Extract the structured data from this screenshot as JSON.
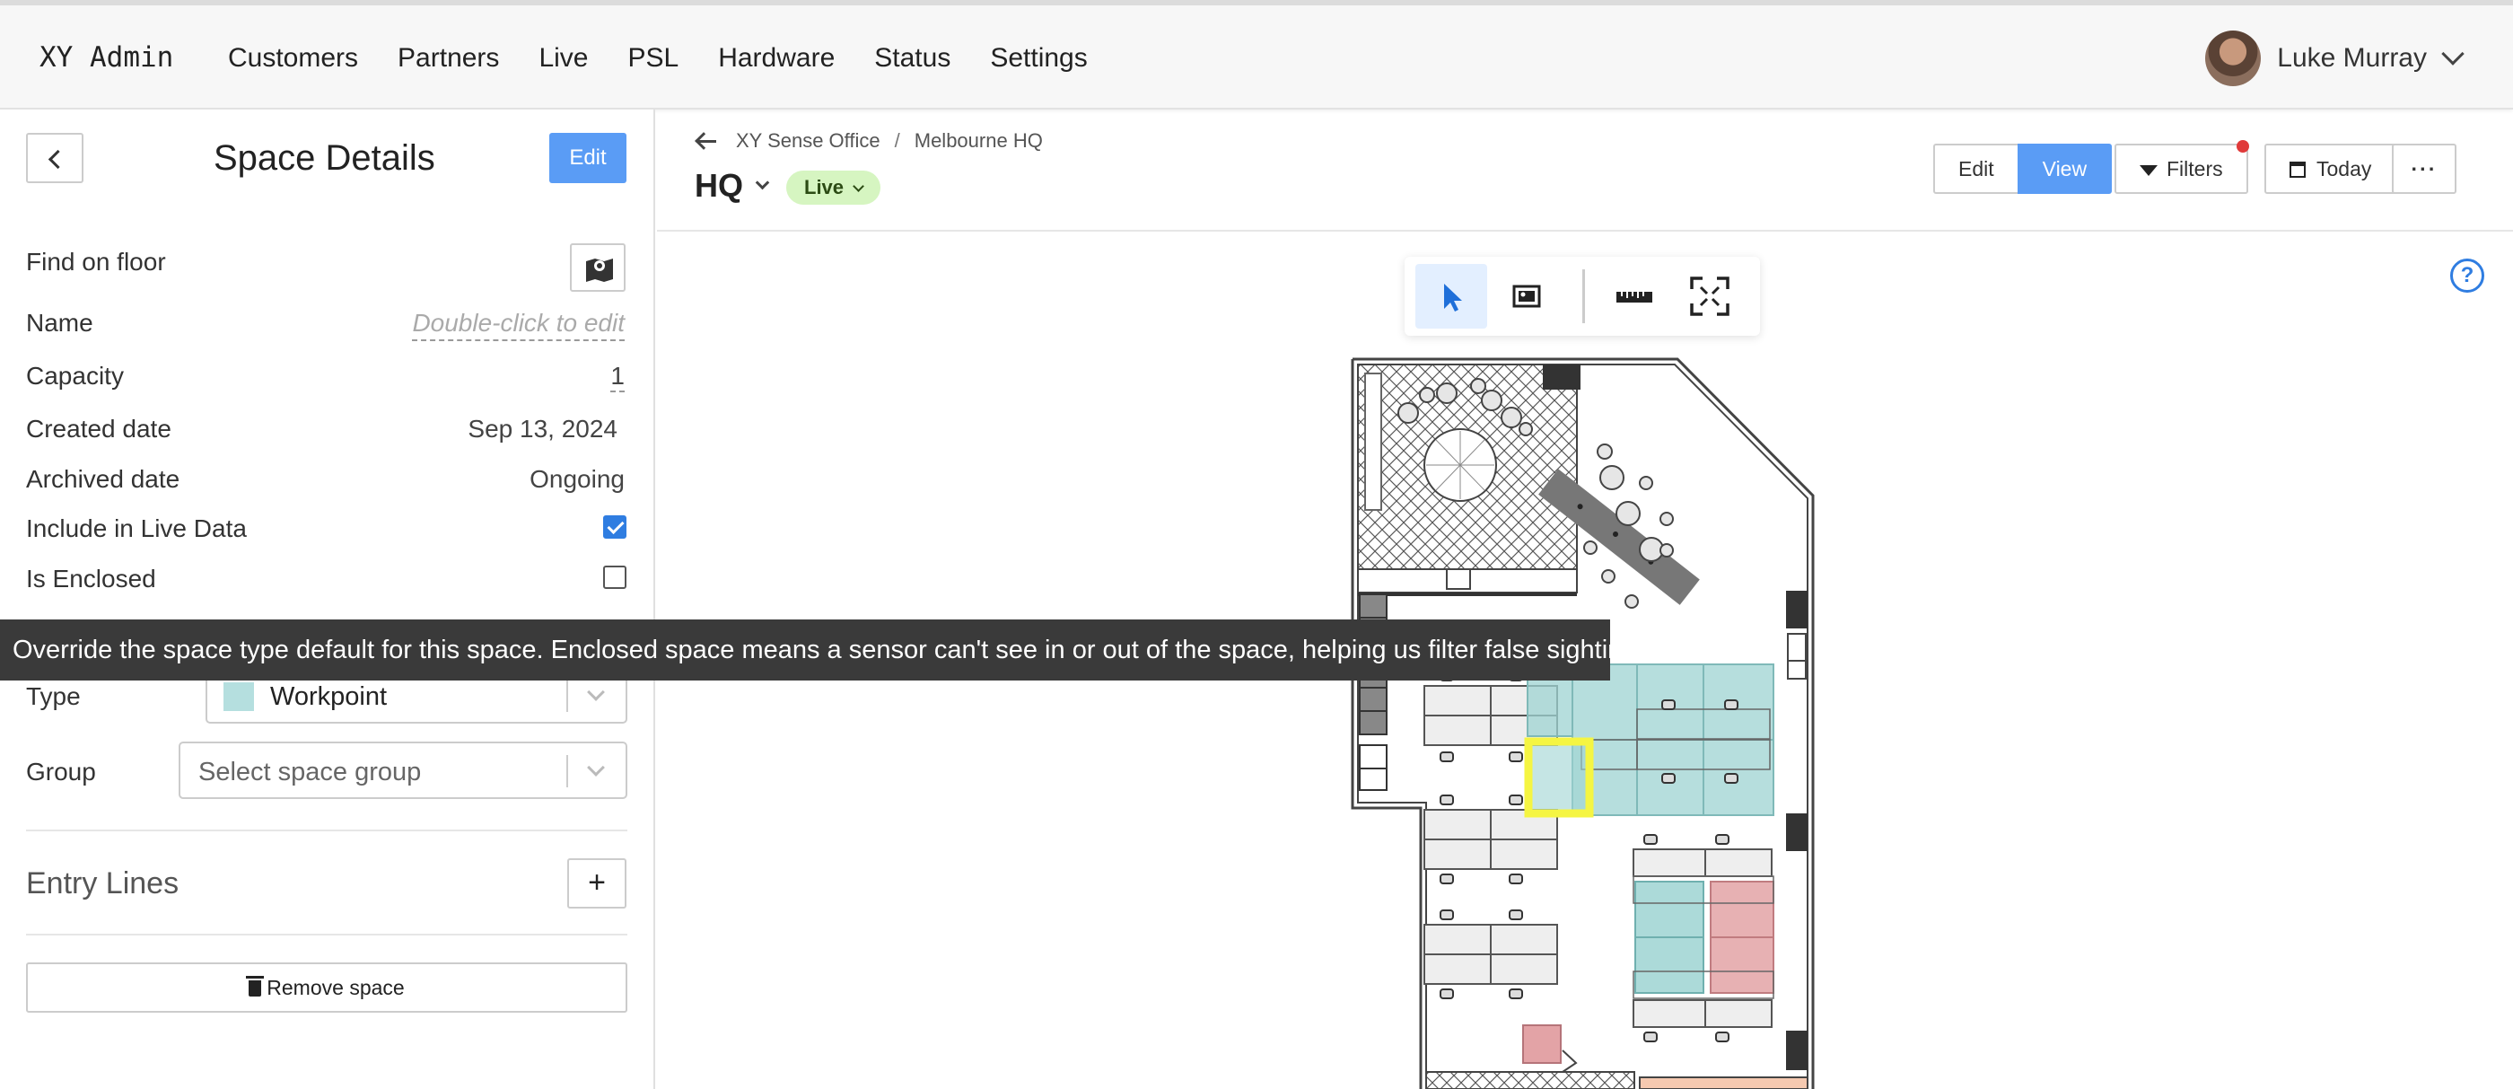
{
  "nav": {
    "brand": "XY Admin",
    "items": [
      "Customers",
      "Partners",
      "Live",
      "PSL",
      "Hardware",
      "Status",
      "Settings"
    ],
    "user_name": "Luke Murray"
  },
  "sidebar": {
    "title": "Space Details",
    "edit_label": "Edit",
    "find_on_floor_label": "Find on floor",
    "name_label": "Name",
    "name_placeholder": "Double-click to edit",
    "capacity_label": "Capacity",
    "capacity_value": "1",
    "created_label": "Created date",
    "created_value": "Sep 13, 2024",
    "archived_label": "Archived date",
    "archived_value": "Ongoing",
    "include_live_label": "Include in Live Data",
    "include_live_checked": true,
    "enclosed_label": "Is Enclosed",
    "enclosed_checked": false,
    "type_label": "Type",
    "type_value": "Workpoint",
    "type_color": "#b5dfdf",
    "group_label": "Group",
    "group_placeholder": "Select space group",
    "entry_lines_label": "Entry Lines",
    "add_label": "+",
    "remove_label": "Remove space"
  },
  "tooltip": {
    "text": "Override the space type default for this space. Enclosed space means a sensor can't see in or out of the space, helping us filter false sightings."
  },
  "main": {
    "breadcrumb": [
      "XY Sense Office",
      "Melbourne HQ"
    ],
    "floor": "HQ",
    "status": "Live",
    "edit_label": "Edit",
    "view_label": "View",
    "filters_label": "Filters",
    "today_label": "Today",
    "more_label": "···",
    "help_label": "?"
  },
  "toolbar": {
    "tools": [
      "select-tool-icon",
      "image-tool-icon",
      "ruler-icon",
      "fit-screen-icon"
    ]
  },
  "colors": {
    "accent": "#5a9cf5",
    "workpoint_fill": "#9ed3d2",
    "selected_outline": "#f5f542",
    "meeting_fill": "#e3a3a6",
    "live_badge": "#d6f5c1"
  }
}
